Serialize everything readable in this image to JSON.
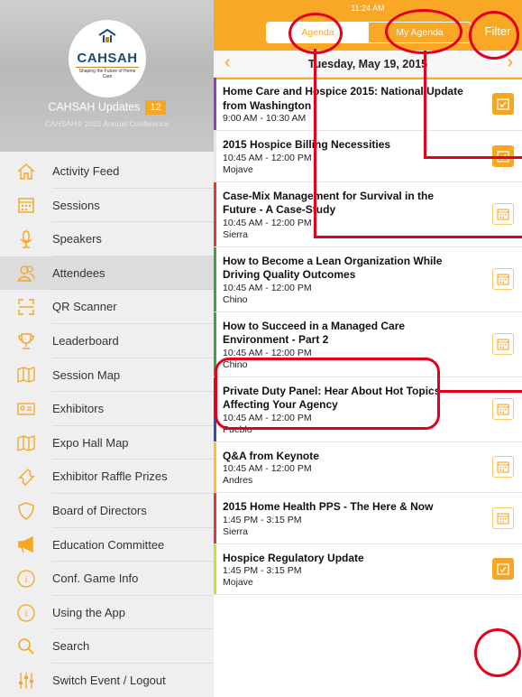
{
  "sidebar": {
    "logo_brand": "CAHSAH",
    "logo_tagline": "Shaping the Future of Home Care",
    "title": "CAHSAH Updates",
    "badge": "12",
    "subtitle": "CAHSAH® 2015 Annual Conference",
    "items": [
      {
        "label": "Activity Feed",
        "icon": "home-icon"
      },
      {
        "label": "Sessions",
        "icon": "calendar-icon"
      },
      {
        "label": "Speakers",
        "icon": "microphone-icon"
      },
      {
        "label": "Attendees",
        "icon": "people-icon"
      },
      {
        "label": "QR Scanner",
        "icon": "qr-scanner-icon"
      },
      {
        "label": "Leaderboard",
        "icon": "trophy-icon"
      },
      {
        "label": "Session Map",
        "icon": "map-icon"
      },
      {
        "label": "Exhibitors",
        "icon": "id-card-icon"
      },
      {
        "label": "Expo Hall Map",
        "icon": "map-icon"
      },
      {
        "label": "Exhibitor Raffle Prizes",
        "icon": "ticket-icon"
      },
      {
        "label": "Board of Directors",
        "icon": "shield-icon"
      },
      {
        "label": "Education Committee",
        "icon": "megaphone-icon"
      },
      {
        "label": "Conf. Game Info",
        "icon": "info-icon"
      },
      {
        "label": "Using the App",
        "icon": "info-icon"
      },
      {
        "label": "Search",
        "icon": "search-icon"
      },
      {
        "label": "Switch Event / Logout",
        "icon": "sliders-icon"
      }
    ]
  },
  "header": {
    "status_time": "11:24 AM",
    "tab_agenda": "Agenda",
    "tab_my_agenda": "My Agenda",
    "filter_label": "Filter",
    "date": "Tuesday, May 19, 2015"
  },
  "sessions": [
    {
      "title": "Home Care and Hospice 2015: National Update from Washington",
      "time": "9:00 AM - 10:30 AM",
      "room": "",
      "color": "#8e44ad",
      "added": true
    },
    {
      "title": "2015 Hospice Billing Necessities",
      "time": "10:45 AM - 12:00 PM",
      "room": "Mojave",
      "color": "#e8e8e8",
      "added": true
    },
    {
      "title": "Case-Mix Management for Survival in the Future - A Case-Study",
      "time": "10:45 AM - 12:00 PM",
      "room": "Sierra",
      "color": "#e53935",
      "added": false
    },
    {
      "title": "How to Become a Lean Organization While Driving Quality Outcomes",
      "time": "10:45 AM - 12:00 PM",
      "room": "Chino",
      "color": "#43a047",
      "added": false
    },
    {
      "title": "How to Succeed in a Managed Care Environment - Part 2",
      "time": "10:45 AM - 12:00 PM",
      "room": "Chino",
      "color": "#43a047",
      "added": false
    },
    {
      "title": "Private Duty Panel: Hear About Hot Topics Affecting Your Agency",
      "time": "10:45 AM - 12:00 PM",
      "room": "Pueblo",
      "color": "#3949ab",
      "added": false
    },
    {
      "title": "Q&A from Keynote",
      "time": "10:45 AM - 12:00 PM",
      "room": "Andres",
      "color": "#fbc02d",
      "added": false
    },
    {
      "title": "2015 Home Health PPS - The Here & Now",
      "time": "1:45 PM - 3:15 PM",
      "room": "Sierra",
      "color": "#e53935",
      "added": false
    },
    {
      "title": "Hospice Regulatory Update",
      "time": "1:45 PM - 3:15 PM",
      "room": "Mojave",
      "color": "#cddc39",
      "added": true
    }
  ],
  "colors": {
    "accent": "#f9a825",
    "annotation": "#e4001b"
  }
}
